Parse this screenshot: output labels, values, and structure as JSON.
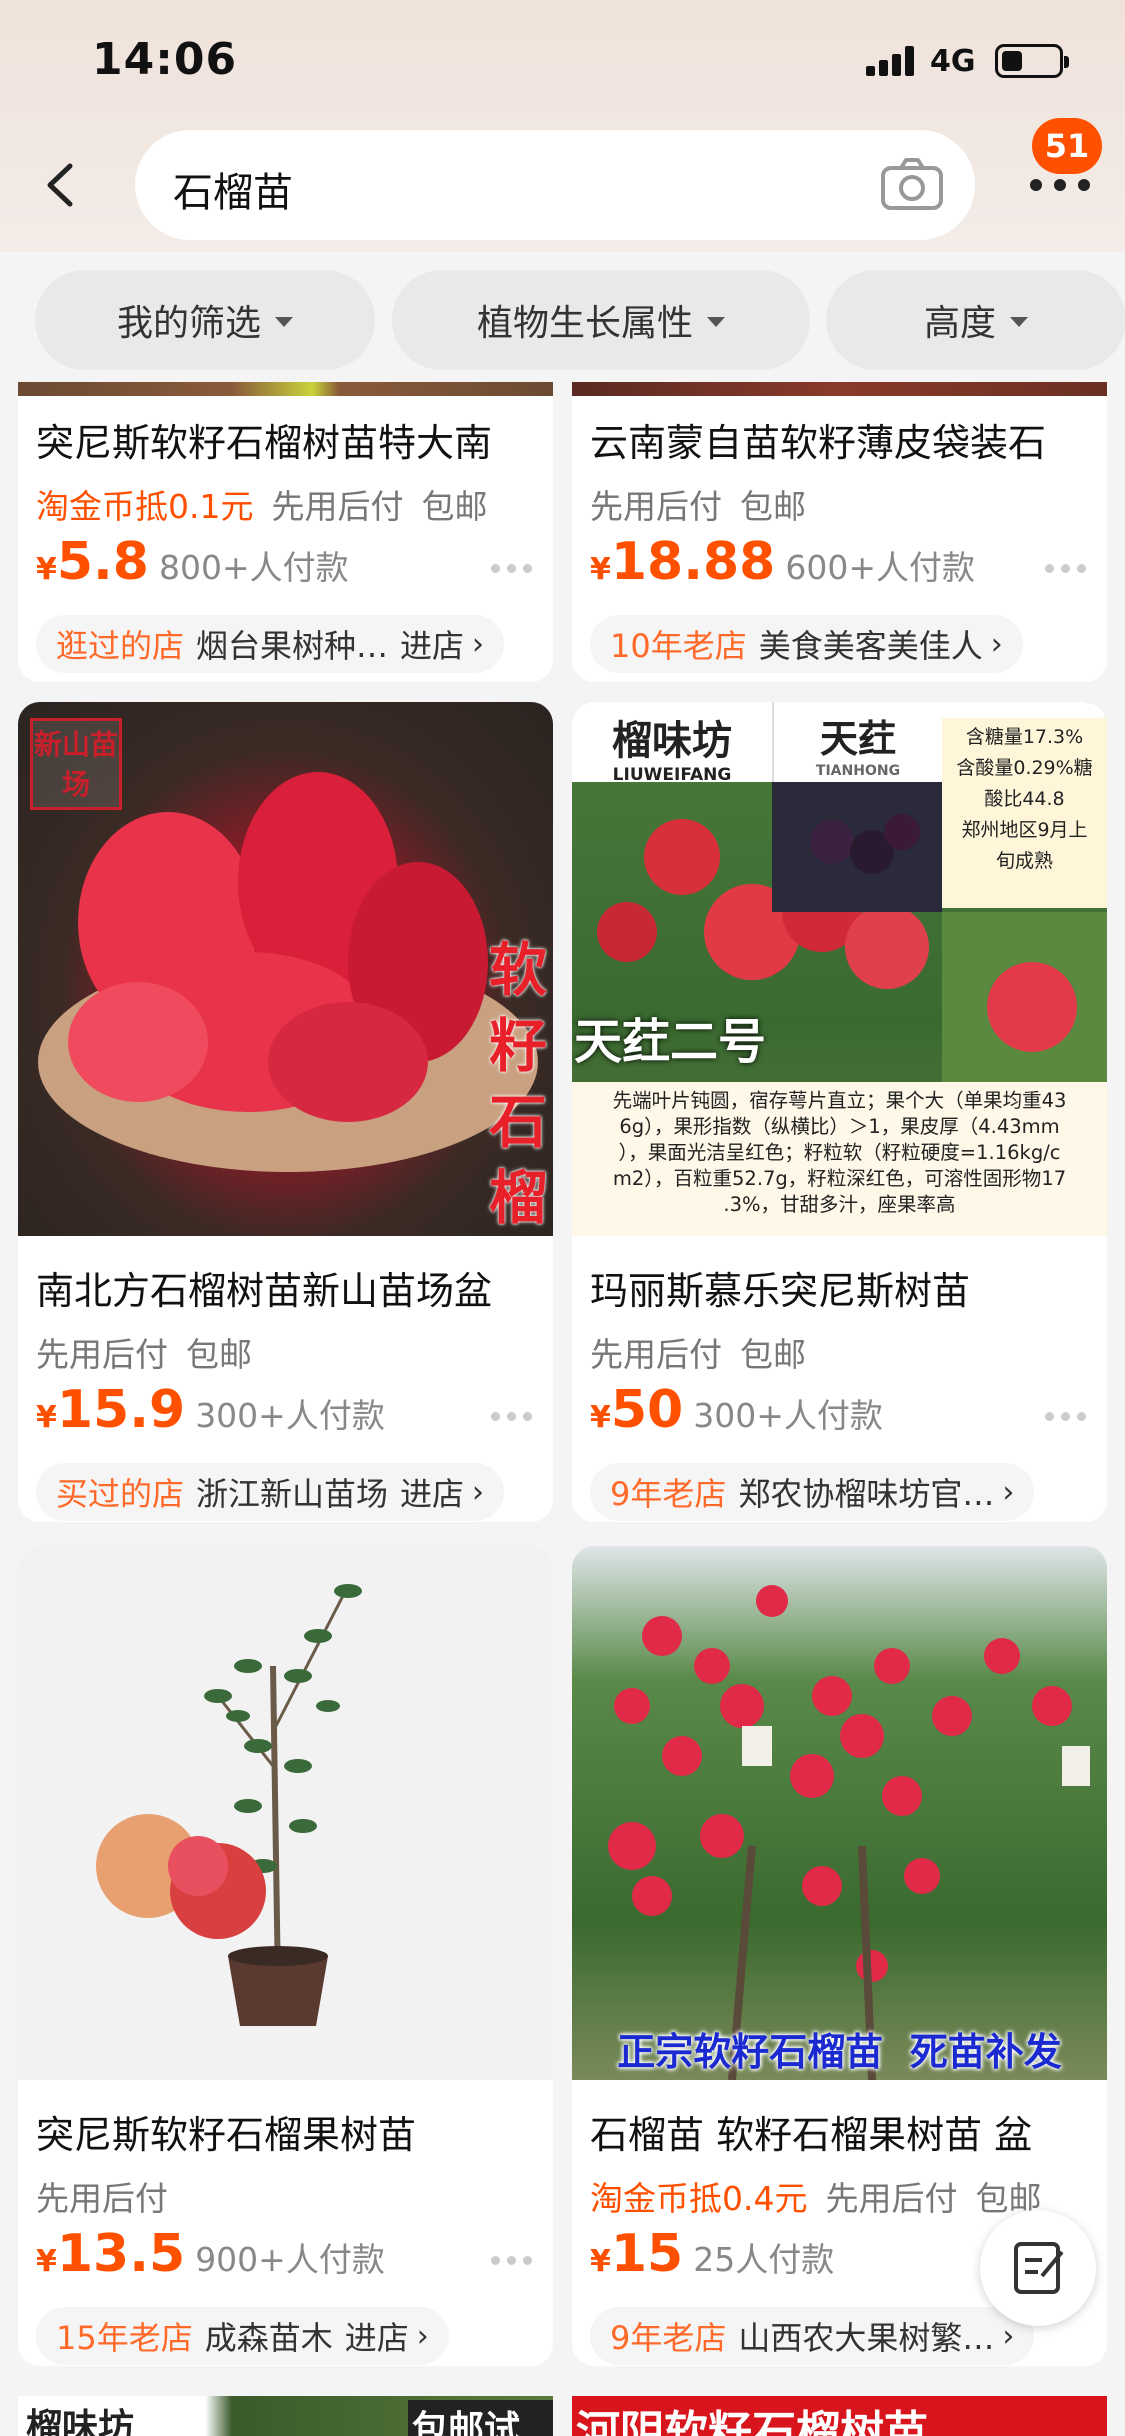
{
  "status": {
    "time": "14:06",
    "network": "4G"
  },
  "header": {
    "search_query": "石榴苗",
    "notification_count": "51"
  },
  "filters": [
    {
      "label": "我的筛选"
    },
    {
      "label": "植物生长属性"
    },
    {
      "label": "高度"
    }
  ],
  "products": [
    {
      "title": "突尼斯软籽石榴树苗特大南",
      "coin": "淘金币抵0.1元",
      "tags": [
        "先用后付",
        "包邮"
      ],
      "price_symbol": "¥",
      "price": "5.8",
      "sold": "800+人付款",
      "shop_label": "逛过的店",
      "shop_name": "烟台果树种…",
      "shop_enter": "进店"
    },
    {
      "title": "云南蒙自苗软籽薄皮袋装石",
      "coin": "",
      "tags": [
        "先用后付",
        "包邮"
      ],
      "price_symbol": "¥",
      "price": "18.88",
      "sold": "600+人付款",
      "shop_label": "10年老店",
      "shop_name": "美食美客美佳人",
      "shop_enter": ""
    },
    {
      "title": "南北方石榴树苗新山苗场盆",
      "coin": "",
      "tags": [
        "先用后付",
        "包邮"
      ],
      "price_symbol": "¥",
      "price": "15.9",
      "sold": "300+人付款",
      "shop_label": "买过的店",
      "shop_name": "浙江新山苗场",
      "shop_enter": "进店",
      "image_texts": {
        "stamp": "新山苗场",
        "vertical": "软籽石榴"
      }
    },
    {
      "title": "玛丽斯慕乐突尼斯树苗",
      "coin": "",
      "tags": [
        "先用后付",
        "包邮"
      ],
      "price_symbol": "¥",
      "price": "50",
      "sold": "300+人付款",
      "shop_label": "9年老店",
      "shop_name": "郑农协榴味坊官…",
      "shop_enter": "",
      "image_texts": {
        "brand1": "榴味坊",
        "brand1_en": "LIUWEIFANG",
        "brand2": "天荭",
        "brand2_en": "TIANHONG",
        "variety": "天荭二号",
        "side_note": [
          "含糖量17.3%",
          "含酸量0.29%糖",
          "酸比44.8",
          "郑州地区9月上",
          "旬成熟"
        ],
        "spec": [
          "先端叶片钝圆，宿存萼片直立；果个大（单果均重43",
          "6g），果形指数（纵横比）＞1，果皮厚（4.43mm",
          "），果面光洁呈红色；籽粒软（籽粒硬度=1.16kg/c",
          "m2），百粒重52.7g，籽粒深红色，可溶性固形物17",
          ".3%，甘甜多汁，座果率高"
        ]
      }
    },
    {
      "title": "突尼斯软籽石榴果树苗",
      "coin": "",
      "tags": [
        "先用后付"
      ],
      "price_symbol": "¥",
      "price": "13.5",
      "sold": "900+人付款",
      "shop_label": "15年老店",
      "shop_name": "成森苗木",
      "shop_enter": "进店"
    },
    {
      "title": "石榴苗 软籽石榴果树苗 盆",
      "coin": "淘金币抵0.4元",
      "tags": [
        "先用后付",
        "包邮"
      ],
      "price_symbol": "¥",
      "price": "15",
      "sold": "25人付款",
      "shop_label": "9年老店",
      "shop_name": "山西农大果树繁…",
      "shop_enter": "",
      "image_texts": {
        "banner": "正宗软籽石榴苗  死苗补发"
      }
    }
  ],
  "bottom_peek": {
    "left": "榴味坊",
    "middle": "包邮试种",
    "right": "河阴软籽石榴树苗"
  },
  "colors": {
    "accent": "#ff5000",
    "shop_label": "#ff6a2a"
  }
}
